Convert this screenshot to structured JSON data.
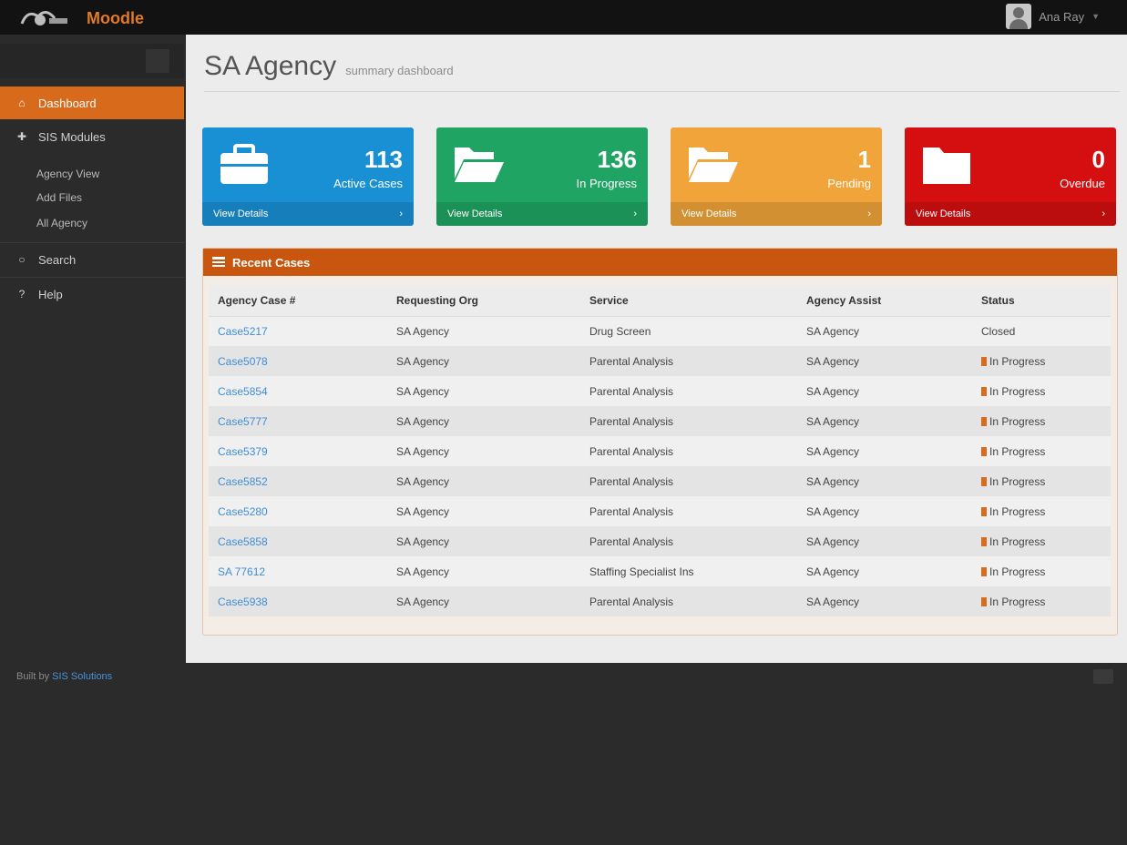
{
  "header": {
    "brand": "Moodle",
    "user_name": "Ana Ray"
  },
  "sidebar": {
    "items": [
      {
        "label": "Dashboard",
        "icon": "home-icon"
      },
      {
        "label": "SIS Modules",
        "icon": "puzzle-icon"
      },
      {
        "label": "Search",
        "icon": "search-icon"
      },
      {
        "label": "Help",
        "icon": "help-icon"
      }
    ],
    "subitems": [
      "Agency View",
      "Add Files",
      "All Agency"
    ],
    "footer_prefix": "Built by",
    "footer_link": "SIS Solutions"
  },
  "page": {
    "title": "SA Agency",
    "subtitle": "summary dashboard"
  },
  "cards": [
    {
      "number": "113",
      "label": "Active Cases",
      "footer": "View Details",
      "color": "#1a90d4",
      "icon": "briefcase-icon"
    },
    {
      "number": "136",
      "label": "In Progress",
      "footer": "View Details",
      "color": "#1fa463",
      "icon": "open-folder-icon"
    },
    {
      "number": "1",
      "label": "Pending",
      "footer": "View Details",
      "color": "#f0a43a",
      "icon": "open-folder-icon"
    },
    {
      "number": "0",
      "label": "Overdue",
      "footer": "View Details",
      "color": "#d50f10",
      "icon": "folder-icon"
    }
  ],
  "panel": {
    "title": "Recent Cases"
  },
  "table": {
    "columns": [
      "Agency Case #",
      "Requesting Org",
      "Service",
      "Agency Assist",
      "Status"
    ],
    "rows": [
      [
        "Case5217",
        "SA Agency",
        "Drug Screen",
        "SA Agency",
        "Closed"
      ],
      [
        "Case5078",
        "SA Agency",
        "Parental Analysis",
        "SA Agency",
        "In Progress"
      ],
      [
        "Case5854",
        "SA Agency",
        "Parental Analysis",
        "SA Agency",
        "In Progress"
      ],
      [
        "Case5777",
        "SA Agency",
        "Parental Analysis",
        "SA Agency",
        "In Progress"
      ],
      [
        "Case5379",
        "SA Agency",
        "Parental Analysis",
        "SA Agency",
        "In Progress"
      ],
      [
        "Case5852",
        "SA Agency",
        "Parental Analysis",
        "SA Agency",
        "In Progress"
      ],
      [
        "Case5280",
        "SA Agency",
        "Parental Analysis",
        "SA Agency",
        "In Progress"
      ],
      [
        "Case5858",
        "SA Agency",
        "Parental Analysis",
        "SA Agency",
        "In Progress"
      ],
      [
        "SA 77612",
        "SA Agency",
        "Staffing Specialist Ins",
        "SA Agency",
        "In Progress"
      ],
      [
        "Case5938",
        "SA Agency",
        "Parental Analysis",
        "SA Agency",
        "In Progress"
      ]
    ]
  }
}
